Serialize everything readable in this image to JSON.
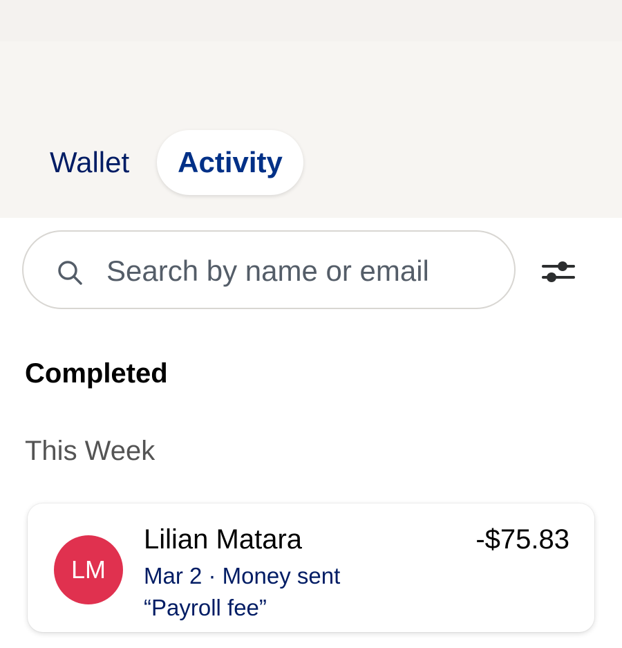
{
  "tabs": [
    {
      "label": "Wallet",
      "active": false
    },
    {
      "label": "Activity",
      "active": true
    }
  ],
  "search": {
    "placeholder": "Search by name or email",
    "value": ""
  },
  "icons": {
    "search": "search-icon",
    "filter": "sliders-filter-icon"
  },
  "section": {
    "title": "Completed"
  },
  "group": {
    "title": "This Week"
  },
  "transactions": [
    {
      "initials": "LM",
      "name": "Lilian Matara",
      "meta": "Mar 2 · Money sent",
      "note": "“Payroll fee”",
      "amount": "-$75.83",
      "avatar_color": "#e0314f"
    }
  ],
  "colors": {
    "header_bg": "#f7f5f2",
    "brand_navy": "#001c64",
    "active_tab_text": "#003087"
  }
}
